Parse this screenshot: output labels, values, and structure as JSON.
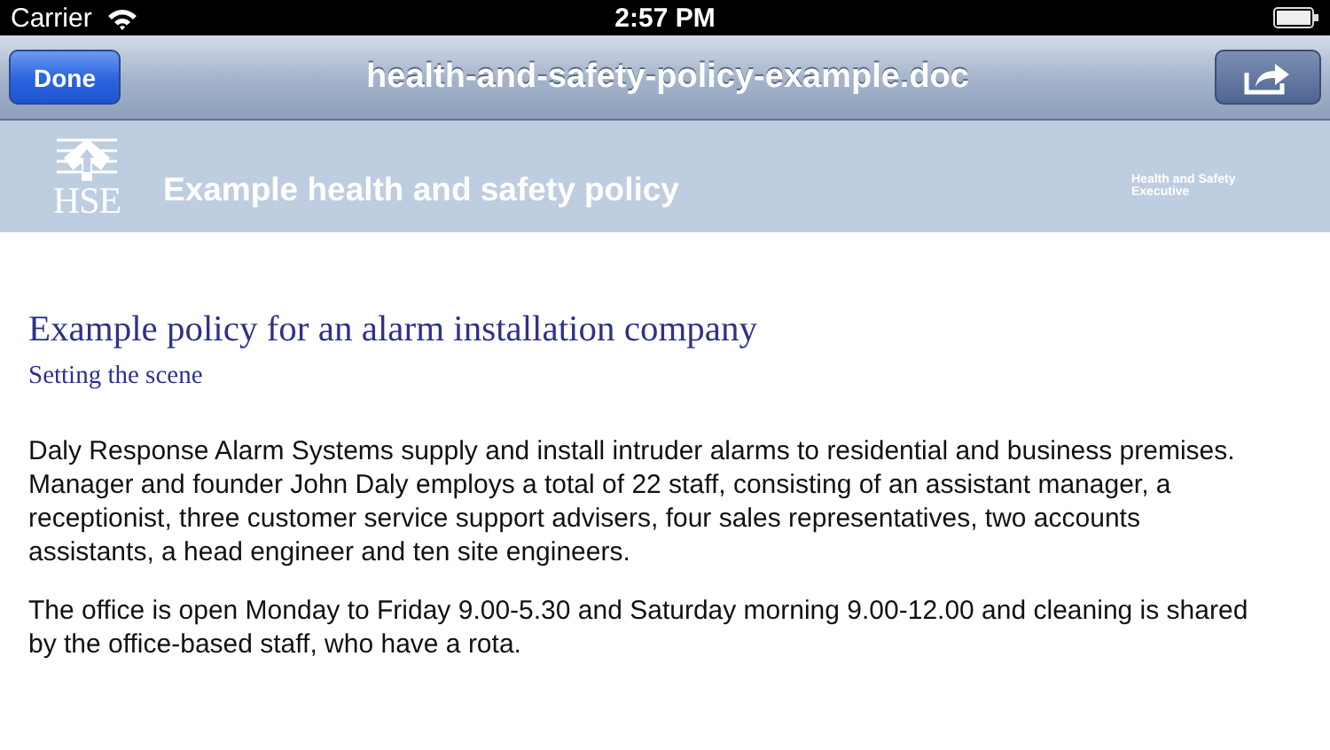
{
  "status_bar": {
    "carrier": "Carrier",
    "time": "2:57 PM"
  },
  "nav_bar": {
    "done_button": "Done",
    "title": "health-and-safety-policy-example.doc"
  },
  "banner": {
    "logo_text": "HSE",
    "title": "Example health and safety policy",
    "organisation_lines": [
      "Health and Safety",
      "Executive"
    ]
  },
  "document": {
    "heading": "Example policy for an alarm installation company",
    "subheading": "Setting the scene",
    "paragraphs": [
      "Daly Response Alarm Systems supply and install intruder alarms to residential and business premises. Manager and founder John Daly employs a total of 22 staff, consisting of an assistant manager, a receptionist, three customer service support advisers, four sales representatives, two accounts assistants, a head engineer and ten site engineers.",
      "The office is open Monday to Friday 9.00-5.30 and Saturday morning 9.00-12.00 and cleaning is shared by the office-based staff, who have a rota."
    ]
  }
}
